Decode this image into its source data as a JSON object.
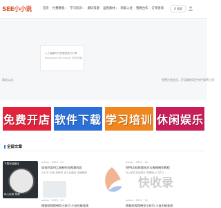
{
  "header": {
    "logo_text": "SEE小小说",
    "nav": [
      {
        "label": "首页"
      },
      {
        "label": "付费教程",
        "dropdown": true
      },
      {
        "label": "学习培训",
        "dropdown": true
      },
      {
        "label": "源码资源"
      },
      {
        "label": "运营素材",
        "dropdown": true
      },
      {
        "label": "商家入驻"
      },
      {
        "label": "我要合作"
      },
      {
        "label": "订单查询"
      }
    ],
    "search_label": "Q 搜索",
    "user_icon": "user-icon"
  },
  "banner": {
    "card_line1": "人工智能时代的赚钱技巧分享",
    "card_line2": "Response this design 好的资源",
    "announce_label": "网站公告：",
    "announce_right": "免费注册会员，开设赚钱项目专栏即将上线"
  },
  "tiles": [
    {
      "label": "免费开店",
      "color": "#e1243c"
    },
    {
      "label": "软件下载",
      "color": "#2c6fd6"
    },
    {
      "label": "学习培训",
      "color": "#f0861f"
    },
    {
      "label": "休闲娱乐",
      "color": "#c81d58"
    }
  ],
  "section": {
    "title": "全部文章"
  },
  "articles": [
    {
      "meta": "admin · 2023 · 10",
      "title": "如何利用AI工具制作短视频内容",
      "desc": "小红书 抖音 视频号 全平台通用 详细教程"
    },
    {
      "meta": "admin · 2023 · 10",
      "title": "WPS文档排版技巧与表格制作教程",
      "desc": "办公软件技能提升 零基础入门学习"
    },
    {
      "meta": "admin · 2023 · 10",
      "title": "揭秘短视频带货小技巧 小白也能变现",
      "desc": ""
    },
    {
      "meta": "admin · 2023 · 10",
      "title": "揭秘短视频带货小技巧 小白也能变现",
      "desc": ""
    }
  ],
  "card_thumb": {
    "cap_top": "下载安装最佳",
    "cap_bottom": "私人定制 免费"
  },
  "watermark": {
    "text": "快收录"
  },
  "colors": {
    "accent": "#2b7de1",
    "logo": "#d9532a"
  }
}
